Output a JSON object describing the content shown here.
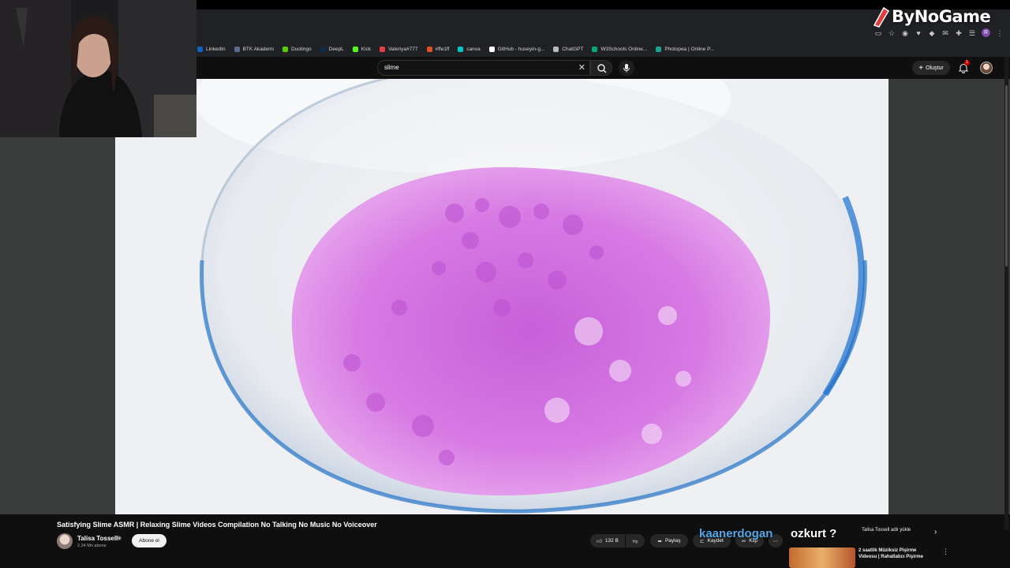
{
  "bookmarks": [
    {
      "label": "LinkedIn",
      "color": "#0a66c2"
    },
    {
      "label": "BTK Akademi",
      "color": "#5a6b8c"
    },
    {
      "label": "Duolingo",
      "color": "#58cc02"
    },
    {
      "label": "DeepL",
      "color": "#0f2b46"
    },
    {
      "label": "Kick",
      "color": "#53fc18"
    },
    {
      "label": "Valeriya#777",
      "color": "#e24040"
    },
    {
      "label": "#ffe1ff",
      "color": "#e34f26"
    },
    {
      "label": "canva",
      "color": "#00c4cc"
    },
    {
      "label": "GitHub - huseyin-g...",
      "color": "#ffffff"
    },
    {
      "label": "ChatGPT",
      "color": "#bbbbbb"
    },
    {
      "label": "W3Schools Online...",
      "color": "#04aa6d"
    },
    {
      "label": "Photopea | Online P...",
      "color": "#18a497"
    }
  ],
  "header": {
    "search_value": "slime",
    "create_label": "Oluştur",
    "notification_count": "1"
  },
  "watermark": "ByNoGame",
  "video": {
    "title": "Satisfying Slime ASMR | Relaxing Slime Videos Compilation No Talking No Music No Voiceover",
    "channel": "Talisa Tossell",
    "subscribers": "2,24 Mn abone",
    "subscribe_label": "Abone ol",
    "likes": "132 B",
    "share_label": "Paylaş",
    "save_label": "Kaydet",
    "clip_label": "Klip"
  },
  "overlay": {
    "name1": "kaanerdogan",
    "name2": "ozkurt ?",
    "chip_upload": "Talisa Tossell adlı yükle"
  },
  "recommendation": {
    "title": "2 saatlik Müziksiz Pişirme Videosu | Rahatlatıcı Pişirme"
  },
  "colors": {
    "accent_red": "#cc0000",
    "slime_pink": "#d77ae4",
    "bowl_blue": "#3f8fd0"
  }
}
